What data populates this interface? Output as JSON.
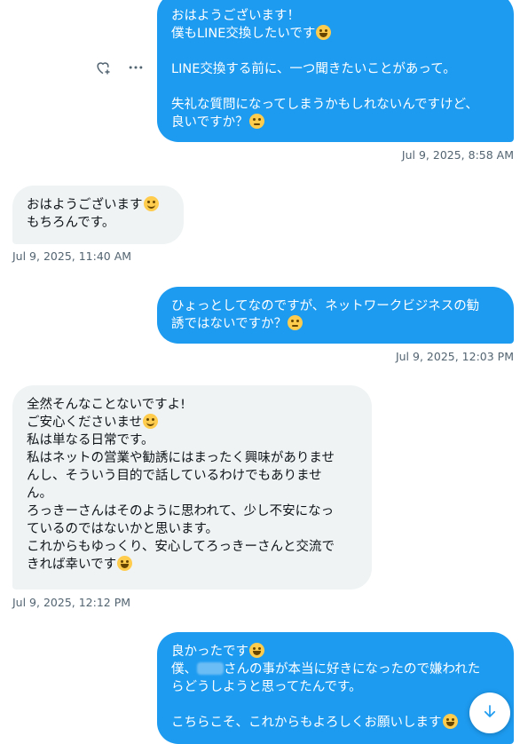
{
  "messages": [
    {
      "id": "m1",
      "direction": "outgoing",
      "lines": [
        [
          "おはようございます！"
        ],
        [
          "僕もLINE交換したいです",
          "emoji:laughing"
        ],
        [
          ""
        ],
        [
          "LINE交換する前に、一つ聞きたいことがあって。"
        ],
        [
          ""
        ],
        [
          "失礼な質問になってしまうかもしれないんですけど、"
        ],
        [
          "良いですか？",
          "emoji:thinking"
        ]
      ],
      "timestamp": "Jul 9, 2025, 8:58 AM"
    },
    {
      "id": "m2",
      "direction": "incoming",
      "lines": [
        [
          "おはようございます",
          "emoji:blush"
        ],
        [
          "もちろんです。"
        ]
      ],
      "timestamp": "Jul 9, 2025, 11:40 AM"
    },
    {
      "id": "m3",
      "direction": "outgoing",
      "lines": [
        [
          "ひょっとしてなのですが、ネットワークビジネスの勧"
        ],
        [
          "誘ではないですか？",
          "emoji:thinking"
        ]
      ],
      "timestamp": "Jul 9, 2025, 12:03 PM"
    },
    {
      "id": "m4",
      "direction": "incoming",
      "lines": [
        [
          "全然そんなことないですよ!"
        ],
        [
          "ご安心くださいませ",
          "emoji:blush"
        ],
        [
          "私は単なる日常です。"
        ],
        [
          "私はネットの営業や勧誘にはまったく興味がありませ"
        ],
        [
          "んし、そういう目的で話しているわけでもありませ"
        ],
        [
          "ん。"
        ],
        [
          "ろっきーさんはそのように思われて、少し不安になっ"
        ],
        [
          "ているのではないかと思います。"
        ],
        [
          "これからもゆっくり、安心してろっきーさんと交流で"
        ],
        [
          "きれば幸いです",
          "emoji:grinning"
        ]
      ],
      "timestamp": "Jul 9, 2025, 12:12 PM"
    },
    {
      "id": "m5",
      "direction": "outgoing",
      "lines": [
        [
          "良かったです",
          "emoji:grin"
        ],
        [
          "僕、",
          "redacted",
          "さんの事が本当に好きになったので嫌われた"
        ],
        [
          "らどうしようと思ってたんです。"
        ],
        [
          ""
        ],
        [
          "こちらこそ、これからもよろしくお願いします",
          "emoji:grin"
        ]
      ],
      "timestamp": ""
    }
  ],
  "actions": {
    "react_icon": "heart-plus-icon",
    "more_icon": "more-horizontal-icon"
  },
  "scroll_button": {
    "icon": "arrow-down-icon"
  },
  "colors": {
    "outgoing_bg": "#1d9bf0",
    "incoming_bg": "#eff3f4",
    "timestamp": "#536471",
    "accent": "#1d9bf0"
  }
}
